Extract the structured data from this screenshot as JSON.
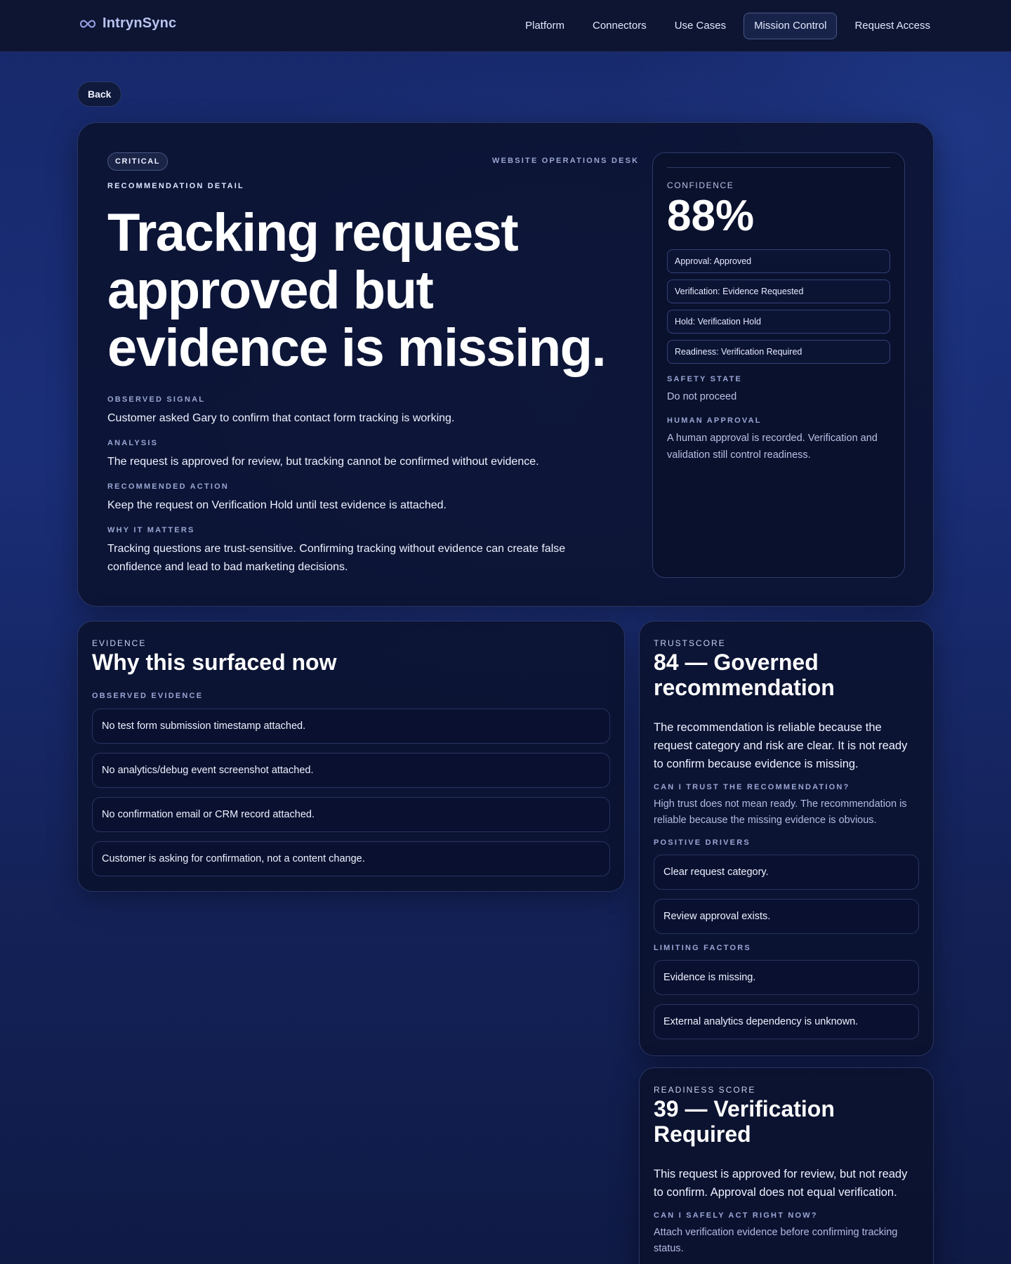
{
  "header": {
    "brand": "IntrynSync",
    "nav": [
      "Platform",
      "Connectors",
      "Use Cases",
      "Mission Control",
      "Request Access"
    ],
    "active_nav": "Mission Control"
  },
  "back_label": "Back",
  "hero": {
    "severity": "CRITICAL",
    "desk": "WEBSITE OPERATIONS DESK",
    "eyebrow": "RECOMMENDATION DETAIL",
    "title": "Tracking request approved but evidence is missing.",
    "sections": [
      {
        "label": "OBSERVED SIGNAL",
        "text": "Customer asked Gary to confirm that contact form tracking is working."
      },
      {
        "label": "ANALYSIS",
        "text": "The request is approved for review, but tracking cannot be confirmed without evidence."
      },
      {
        "label": "RECOMMENDED ACTION",
        "text": "Keep the request on Verification Hold until test evidence is attached."
      },
      {
        "label": "WHY IT MATTERS",
        "text": "Tracking questions are trust-sensitive. Confirming tracking without evidence can create false confidence and lead to bad marketing decisions."
      }
    ]
  },
  "confidence": {
    "label": "CONFIDENCE",
    "value": "88%",
    "chips": [
      "Approval: Approved",
      "Verification: Evidence Requested",
      "Hold: Verification Hold",
      "Readiness: Verification Required"
    ],
    "safety_label": "SAFETY STATE",
    "safety_text": "Do not proceed",
    "human_label": "HUMAN APPROVAL",
    "human_text": "A human approval is recorded. Verification and validation still control readiness."
  },
  "evidence": {
    "eyebrow": "EVIDENCE",
    "title": "Why this surfaced now",
    "sub": "OBSERVED EVIDENCE",
    "items": [
      "No test form submission timestamp attached.",
      "No analytics/debug event screenshot attached.",
      "No confirmation email or CRM record attached.",
      "Customer is asking for confirmation, not a content change."
    ]
  },
  "trust": {
    "eyebrow": "TRUSTSCORE",
    "title": "84 — Governed recommendation",
    "desc": "The recommendation is reliable because the request category and risk are clear. It is not ready to confirm because evidence is missing.",
    "q_label": "CAN I TRUST THE RECOMMENDATION?",
    "q_text": "High trust does not mean ready. The recommendation is reliable because the missing evidence is obvious.",
    "pos_label": "POSITIVE DRIVERS",
    "positives": [
      "Clear request category.",
      "Review approval exists."
    ],
    "lim_label": "LIMITING FACTORS",
    "limits": [
      "Evidence is missing.",
      "External analytics dependency is unknown."
    ]
  },
  "readiness": {
    "eyebrow": "READINESS SCORE",
    "title": "39 — Verification Required",
    "desc": "This request is approved for review, but not ready to confirm. Approval does not equal verification.",
    "q_label": "CAN I SAFELY ACT RIGHT NOW?",
    "q_text": "Attach verification evidence before confirming tracking status."
  }
}
